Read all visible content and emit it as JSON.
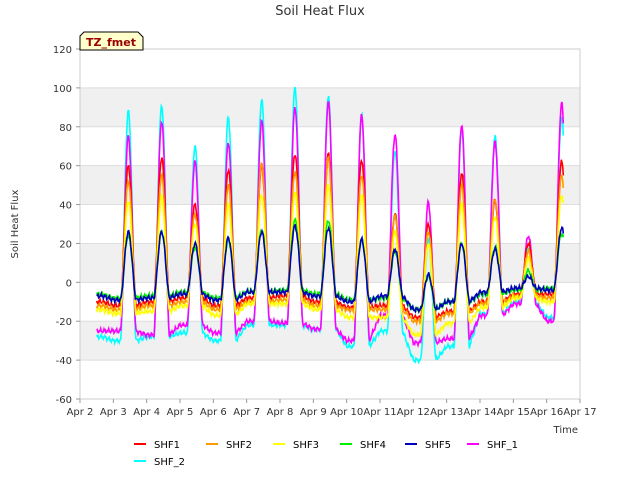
{
  "chart_data": {
    "type": "line",
    "title": "Soil Heat Flux",
    "xlabel": "Time",
    "ylabel": "Soil Heat Flux",
    "badge": "TZ_fmet",
    "ylim": [
      -60,
      120
    ],
    "yticks": [
      -60,
      -40,
      -20,
      0,
      20,
      40,
      60,
      80,
      100,
      120
    ],
    "xlim": [
      2,
      17
    ],
    "xticks": [
      2,
      3,
      4,
      5,
      6,
      7,
      8,
      9,
      10,
      11,
      12,
      13,
      14,
      15,
      16,
      17
    ],
    "xtick_labels": [
      "Apr 2",
      "Apr 3",
      "Apr 4",
      "Apr 5",
      "Apr 6",
      "Apr 7",
      "Apr 8",
      "Apr 9",
      "Apr 10",
      "Apr 11",
      "Apr 12",
      "Apr 13",
      "Apr 14",
      "Apr 15",
      "Apr 16",
      "Apr 17"
    ],
    "grid": "horizontal alternating bands",
    "legend_position": "bottom",
    "series": [
      {
        "name": "SHF_2",
        "color": "#00ffff",
        "base": [
          -28,
          -30,
          -28,
          -26,
          -30,
          -22,
          -22,
          -24,
          -33,
          -25,
          -40,
          -33,
          -16,
          -10,
          -18
        ],
        "peak": [
          88,
          91,
          70,
          85,
          94,
          100,
          96,
          86,
          68,
          22,
          79,
          75,
          18,
          85
        ]
      },
      {
        "name": "SHF_1",
        "color": "#ff00ff",
        "base": [
          -25,
          -25,
          -27,
          -22,
          -26,
          -20,
          -21,
          -24,
          -30,
          -17,
          -31,
          -29,
          -17,
          -11,
          -20
        ],
        "peak": [
          75,
          83,
          62,
          72,
          83,
          90,
          93,
          86,
          76,
          41,
          81,
          72,
          24,
          92
        ]
      },
      {
        "name": "SHF1",
        "color": "#ff0000",
        "base": [
          -10,
          -12,
          -10,
          -8,
          -12,
          -8,
          -7,
          -10,
          -13,
          -12,
          -18,
          -15,
          -10,
          -6,
          -6
        ],
        "peak": [
          60,
          64,
          40,
          58,
          60,
          66,
          66,
          63,
          35,
          30,
          56,
          42,
          20,
          62
        ]
      },
      {
        "name": "SHF2",
        "color": "#ff9900",
        "base": [
          -12,
          -14,
          -12,
          -10,
          -14,
          -10,
          -9,
          -12,
          -14,
          -14,
          -20,
          -16,
          -11,
          -7,
          -8
        ],
        "peak": [
          52,
          55,
          35,
          50,
          61,
          57,
          64,
          55,
          34,
          26,
          50,
          43,
          16,
          55
        ]
      },
      {
        "name": "SHF3",
        "color": "#ffff00",
        "base": [
          -14,
          -16,
          -15,
          -12,
          -17,
          -11,
          -11,
          -14,
          -18,
          -18,
          -27,
          -21,
          -13,
          -8,
          -10
        ],
        "peak": [
          42,
          44,
          30,
          40,
          45,
          46,
          50,
          45,
          26,
          20,
          40,
          34,
          12,
          45
        ]
      },
      {
        "name": "SHF4",
        "color": "#00ee00",
        "base": [
          -6,
          -8,
          -7,
          -5,
          -8,
          -5,
          -4,
          -6,
          -9,
          -8,
          -14,
          -10,
          -6,
          -4,
          -3
        ],
        "peak": [
          24,
          26,
          18,
          22,
          27,
          32,
          32,
          22,
          16,
          3,
          20,
          18,
          6,
          25
        ]
      },
      {
        "name": "SHF5",
        "color": "#0000bb",
        "base": [
          -7,
          -9,
          -8,
          -6,
          -9,
          -5,
          -5,
          -7,
          -10,
          -7,
          -14,
          -10,
          -5,
          -3,
          -4
        ],
        "peak": [
          26,
          26,
          20,
          23,
          26,
          29,
          28,
          22,
          17,
          4,
          20,
          17,
          3,
          28
        ]
      }
    ],
    "legend_order": [
      "SHF1",
      "SHF2",
      "SHF3",
      "SHF4",
      "SHF5",
      "SHF_1",
      "SHF_2"
    ]
  }
}
